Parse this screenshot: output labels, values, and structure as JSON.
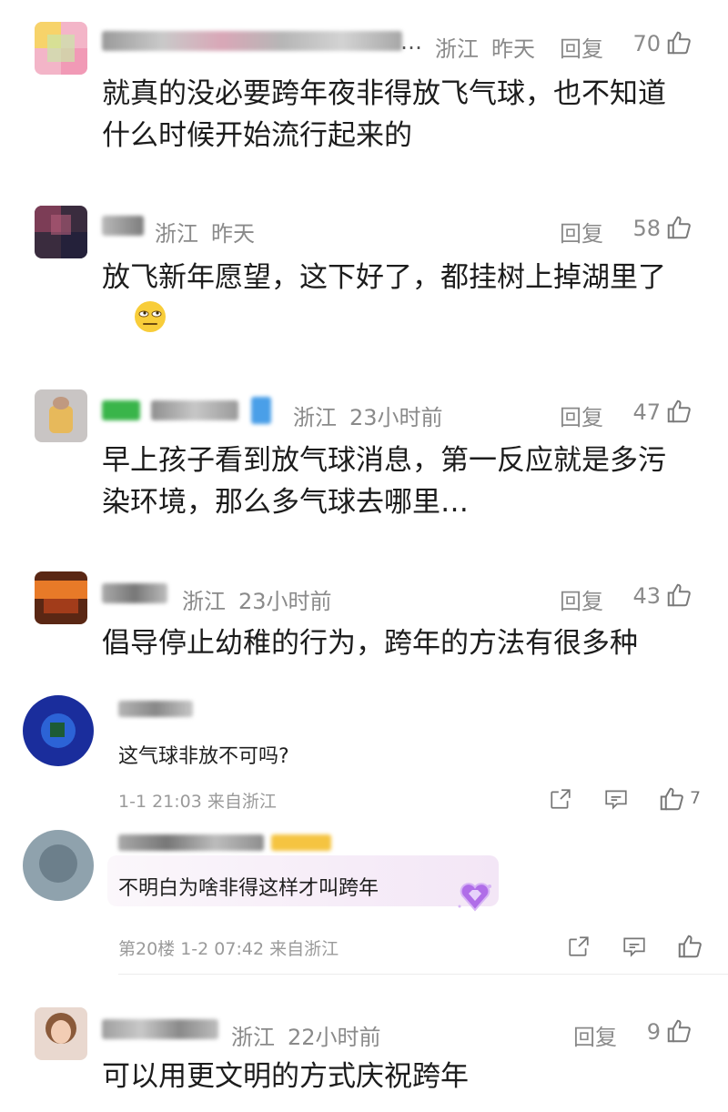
{
  "comments": [
    {
      "location": "浙江",
      "time": "昨天",
      "reply": "回复",
      "likes": "70",
      "text": "就真的没必要跨年夜非得放飞气球，也不知道什么时候开始流行起来的"
    },
    {
      "location": "浙江",
      "time": "昨天",
      "reply": "回复",
      "likes": "58",
      "text": "放飞新年愿望，这下好了，都挂树上掉湖里了"
    },
    {
      "location": "浙江",
      "time": "23小时前",
      "reply": "回复",
      "likes": "47",
      "text": "早上孩子看到放气球消息，第一反应就是多污染环境，那么多气球去哪里…"
    },
    {
      "location": "浙江",
      "time": "23小时前",
      "reply": "回复",
      "likes": "43",
      "text": "倡导停止幼稚的行为，跨年的方法有很多种"
    }
  ],
  "weibo": [
    {
      "text": "这气球非放不可吗?",
      "meta": "1-1 21:03 来自浙江",
      "likes": "7"
    },
    {
      "text": "不明白为啥非得这样才叫跨年",
      "meta": "第20楼 1-2 07:42 来自浙江",
      "likes": ""
    }
  ],
  "last": {
    "location": "浙江",
    "time": "22小时前",
    "reply": "回复",
    "likes": "9",
    "text": "可以用更文明的方式庆祝跨年"
  },
  "ellipsis": "…",
  "colors": {
    "meta": "#8a8a8a",
    "text": "#1c1c1c",
    "highlight": "#f6eef8"
  },
  "icons": [
    "thumb-up-icon",
    "share-icon",
    "comment-icon",
    "heart-gem-icon"
  ]
}
